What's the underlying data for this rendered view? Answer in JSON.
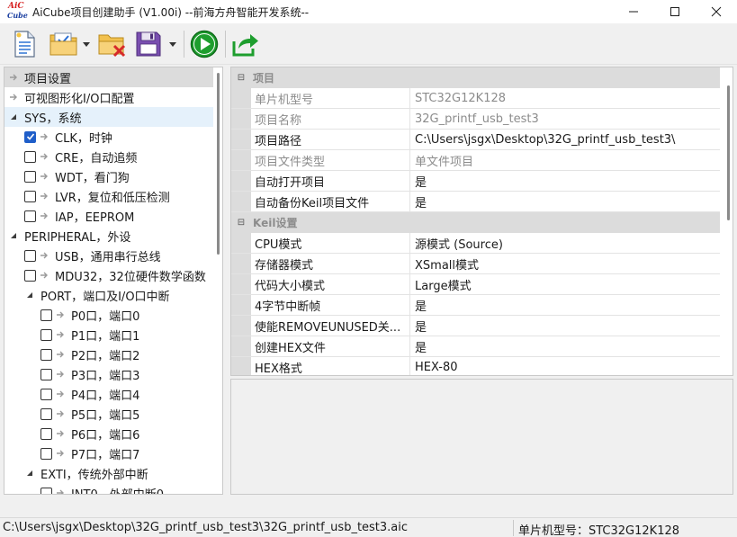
{
  "window": {
    "logo_text_top": "AiC",
    "logo_text_bottom": "Cube",
    "title": "AiCube项目创建助手 (V1.00i) --前海方舟智能开发系统--",
    "minimize_icon": "minimize-icon",
    "maximize_icon": "maximize-icon",
    "close_icon": "close-icon"
  },
  "toolbar": {
    "buttons": [
      {
        "name": "new-project",
        "icon": "new-document-icon"
      },
      {
        "name": "open-project",
        "icon": "open-folder-check-icon"
      },
      {
        "name": "close-project",
        "icon": "folder-delete-icon"
      },
      {
        "name": "save-project",
        "icon": "save-disk-icon"
      },
      {
        "name": "run",
        "icon": "play-icon"
      },
      {
        "name": "export",
        "icon": "export-share-icon"
      }
    ],
    "accent_green": "#1e9e2e"
  },
  "tree": {
    "items": [
      {
        "label": "项目设置",
        "level": 0,
        "type": "arrow",
        "selected": true
      },
      {
        "label": "可视图形化I/O口配置",
        "level": 0,
        "type": "arrow"
      },
      {
        "label": "SYS，系统",
        "level": 0,
        "type": "expanded",
        "highlight": true
      },
      {
        "label": "CLK，时钟",
        "level": 1,
        "type": "check",
        "checked": true
      },
      {
        "label": "CRE，自动追频",
        "level": 1,
        "type": "check"
      },
      {
        "label": "WDT，看门狗",
        "level": 1,
        "type": "check"
      },
      {
        "label": "LVR，复位和低压检测",
        "level": 1,
        "type": "check"
      },
      {
        "label": "IAP，EEPROM",
        "level": 1,
        "type": "check"
      },
      {
        "label": "PERIPHERAL，外设",
        "level": 0,
        "type": "expanded"
      },
      {
        "label": "USB，通用串行总线",
        "level": 1,
        "type": "check"
      },
      {
        "label": "MDU32，32位硬件数学函数",
        "level": 1,
        "type": "check"
      },
      {
        "label": "PORT，端口及I/O口中断",
        "level": 1,
        "type": "expanded"
      },
      {
        "label": "P0口，端口0",
        "level": 2,
        "type": "check"
      },
      {
        "label": "P1口，端口1",
        "level": 2,
        "type": "check"
      },
      {
        "label": "P2口，端口2",
        "level": 2,
        "type": "check"
      },
      {
        "label": "P3口，端口3",
        "level": 2,
        "type": "check"
      },
      {
        "label": "P4口，端口4",
        "level": 2,
        "type": "check"
      },
      {
        "label": "P5口，端口5",
        "level": 2,
        "type": "check"
      },
      {
        "label": "P6口，端口6",
        "level": 2,
        "type": "check"
      },
      {
        "label": "P7口，端口7",
        "level": 2,
        "type": "check"
      },
      {
        "label": "EXTI，传统外部中断",
        "level": 1,
        "type": "expanded"
      },
      {
        "label": "INT0，外部中断0",
        "level": 2,
        "type": "check"
      }
    ]
  },
  "properties": {
    "categories": [
      {
        "label": "项目",
        "rows": [
          {
            "name": "单片机型号",
            "value": "STC32G12K128",
            "readonly": true
          },
          {
            "name": "项目名称",
            "value": "32G_printf_usb_test3",
            "readonly": true
          },
          {
            "name": "项目路径",
            "value": "C:\\Users\\jsgx\\Desktop\\32G_printf_usb_test3\\",
            "readonly": false
          },
          {
            "name": "项目文件类型",
            "value": "单文件项目",
            "readonly": true
          },
          {
            "name": "自动打开项目",
            "value": "是",
            "readonly": false
          },
          {
            "name": "自动备份Keil项目文件",
            "value": "是",
            "readonly": false
          }
        ]
      },
      {
        "label": "Keil设置",
        "rows": [
          {
            "name": "CPU模式",
            "value": "源模式 (Source)",
            "readonly": false
          },
          {
            "name": "存储器模式",
            "value": "XSmall模式",
            "readonly": false
          },
          {
            "name": "代码大小模式",
            "value": "Large模式",
            "readonly": false
          },
          {
            "name": "4字节中断帧",
            "value": "是",
            "readonly": false
          },
          {
            "name": "使能REMOVEUNUSED关...",
            "value": "是",
            "readonly": false
          },
          {
            "name": "创建HEX文件",
            "value": "是",
            "readonly": false
          },
          {
            "name": "HEX格式",
            "value": "HEX-80",
            "readonly": false
          }
        ]
      }
    ]
  },
  "statusbar": {
    "path": "C:\\Users\\jsgx\\Desktop\\32G_printf_usb_test3\\32G_printf_usb_test3.aic",
    "mcu": "单片机型号：STC32G12K128"
  }
}
